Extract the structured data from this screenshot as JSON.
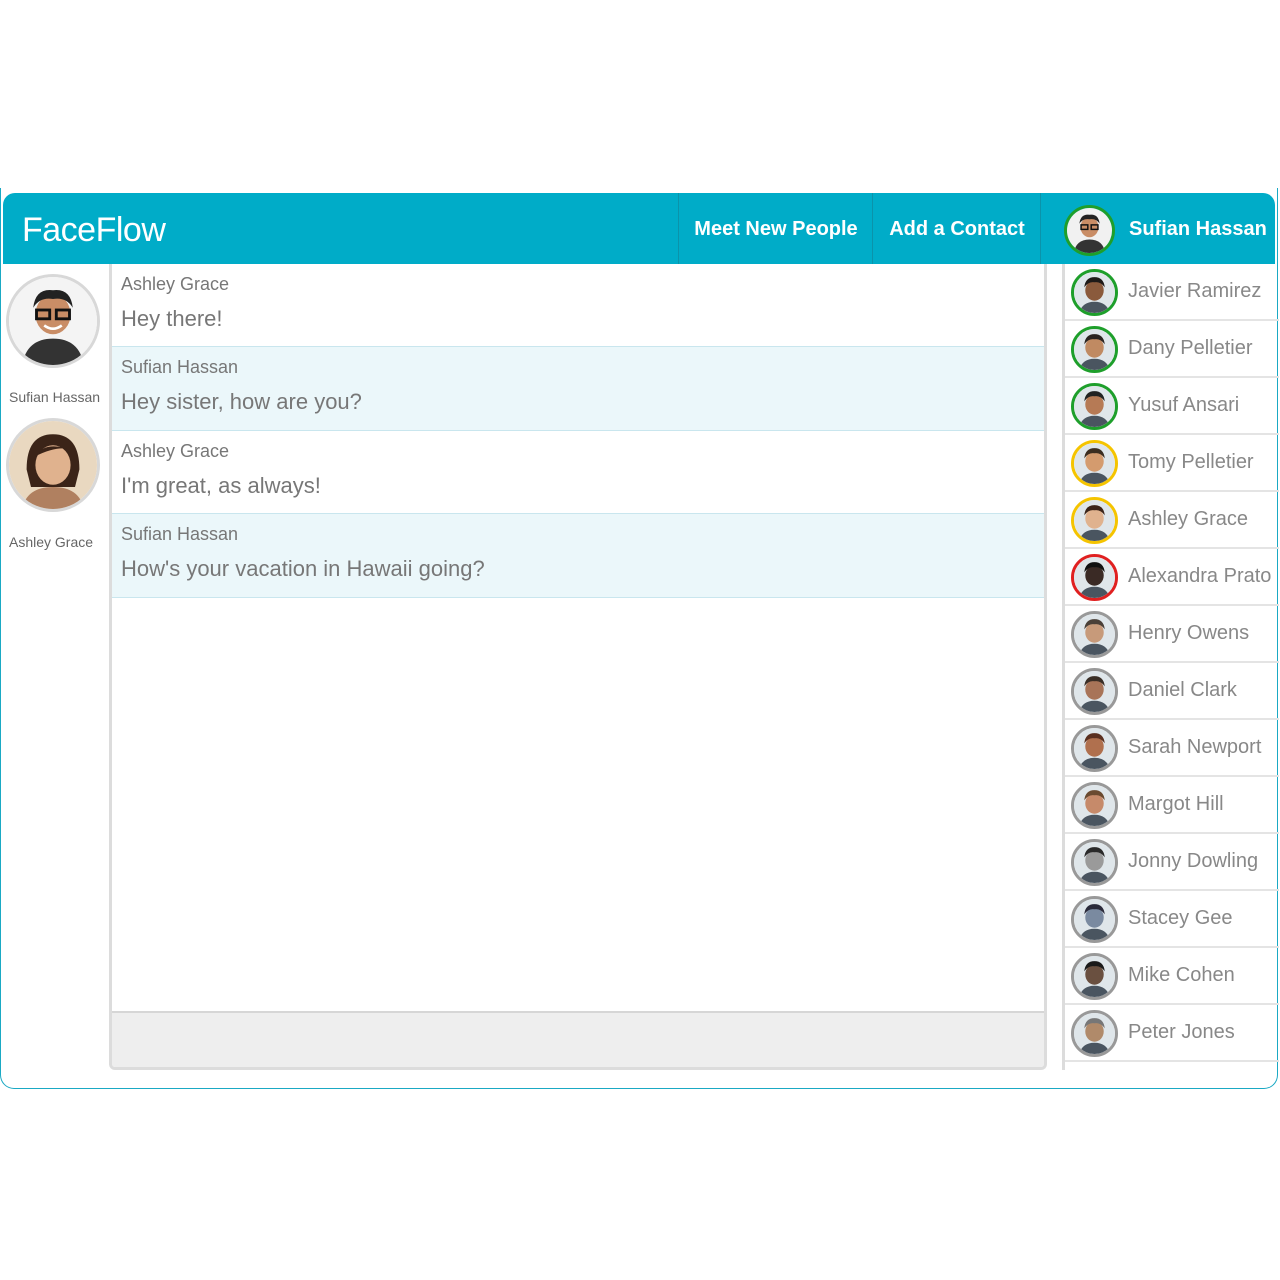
{
  "app": {
    "brand": "FaceFlow",
    "accent_color": "#00acc8"
  },
  "nav": {
    "meet_new_people": "Meet New People",
    "add_contact": "Add a Contact",
    "current_user": "Sufian Hassan"
  },
  "participants": [
    {
      "name": "Sufian Hassan",
      "icon": "avatar"
    },
    {
      "name": "Ashley Grace",
      "icon": "avatar"
    }
  ],
  "messages": [
    {
      "from": "Ashley Grace",
      "text": "Hey there!"
    },
    {
      "from": "Sufian Hassan",
      "text": "Hey sister, how are you?"
    },
    {
      "from": "Ashley Grace",
      "text": "I'm great, as always!"
    },
    {
      "from": "Sufian Hassan",
      "text": "How's your vacation in Hawaii going?"
    }
  ],
  "compose": {
    "value": ""
  },
  "contacts": [
    {
      "name": "Javier Ramirez",
      "status_color": "#1e9f2b"
    },
    {
      "name": "Dany Pelletier",
      "status_color": "#1e9f2b"
    },
    {
      "name": "Yusuf Ansari",
      "status_color": "#1e9f2b"
    },
    {
      "name": "Tomy Pelletier",
      "status_color": "#f5c400"
    },
    {
      "name": "Ashley Grace",
      "status_color": "#f5c400"
    },
    {
      "name": "Alexandra Prato",
      "status_color": "#e02020"
    },
    {
      "name": "Henry Owens",
      "status_color": "#999999"
    },
    {
      "name": "Daniel Clark",
      "status_color": "#999999"
    },
    {
      "name": "Sarah Newport",
      "status_color": "#999999"
    },
    {
      "name": "Margot Hill",
      "status_color": "#999999"
    },
    {
      "name": "Jonny Dowling",
      "status_color": "#999999"
    },
    {
      "name": "Stacey Gee",
      "status_color": "#999999"
    },
    {
      "name": "Mike Cohen",
      "status_color": "#999999"
    },
    {
      "name": "Peter Jones",
      "status_color": "#999999"
    }
  ]
}
